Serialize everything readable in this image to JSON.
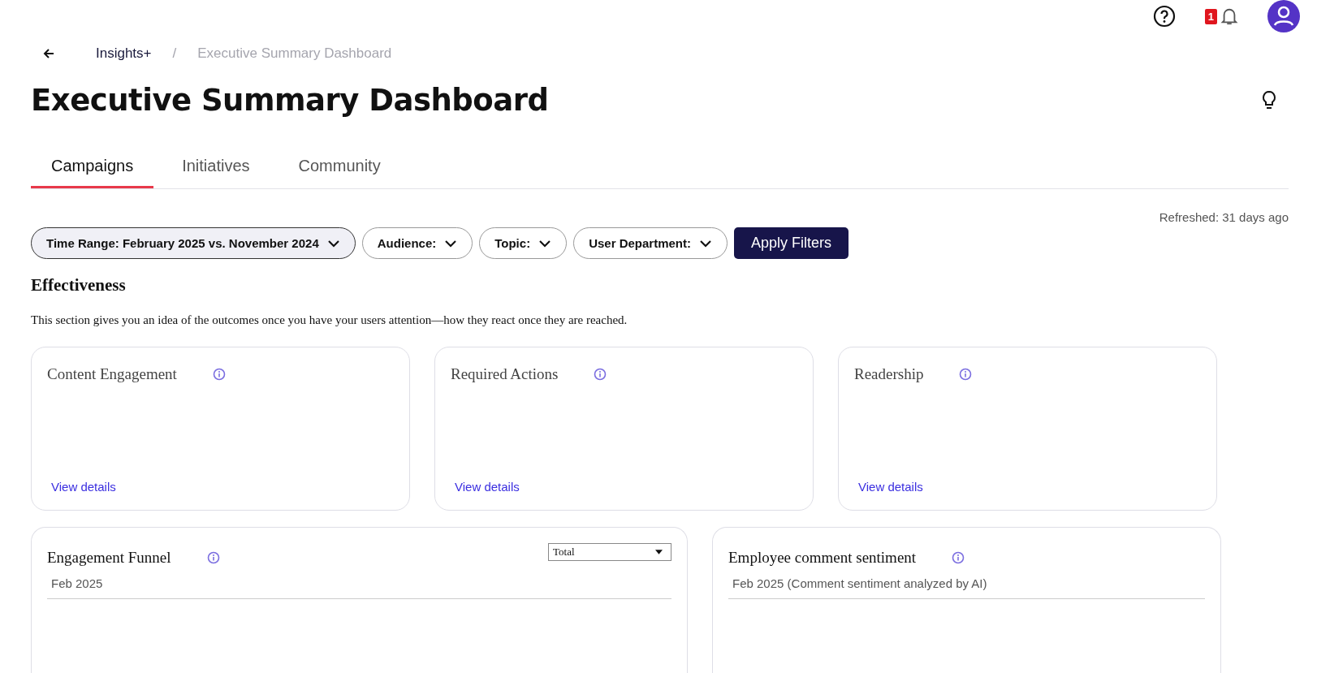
{
  "header": {
    "notification_count": "1"
  },
  "breadcrumb": {
    "items": [
      "Insights+",
      "Executive Summary Dashboard"
    ],
    "separator": "/"
  },
  "title": "Executive Summary Dashboard",
  "tabs": [
    {
      "label": "Campaigns",
      "selected": true
    },
    {
      "label": "Initiatives",
      "selected": false
    },
    {
      "label": "Community",
      "selected": false
    }
  ],
  "refreshed": "Refreshed: 31 days ago",
  "filters": [
    {
      "label": "Time Range: February 2025 vs. November 2024",
      "selected": true
    },
    {
      "label": "Audience:",
      "selected": false
    },
    {
      "label": "Topic:",
      "selected": false
    },
    {
      "label": "User Department:",
      "selected": false
    }
  ],
  "apply_button": "Apply Filters",
  "section": {
    "heading": "Effectiveness",
    "description": "This section gives you an idea of the outcomes once you have your users attention—how they react once they are reached."
  },
  "metric_cards": [
    {
      "title": "Content Engagement",
      "link": "View details"
    },
    {
      "title": "Required Actions",
      "link": "View details"
    },
    {
      "title": "Readership",
      "link": "View details"
    }
  ],
  "panels": [
    {
      "title": "Engagement Funnel",
      "subtitle": "Feb 2025",
      "select": "Total"
    },
    {
      "title": "Employee comment sentiment",
      "subtitle": "Feb 2025 (Comment sentiment analyzed by AI)"
    }
  ]
}
